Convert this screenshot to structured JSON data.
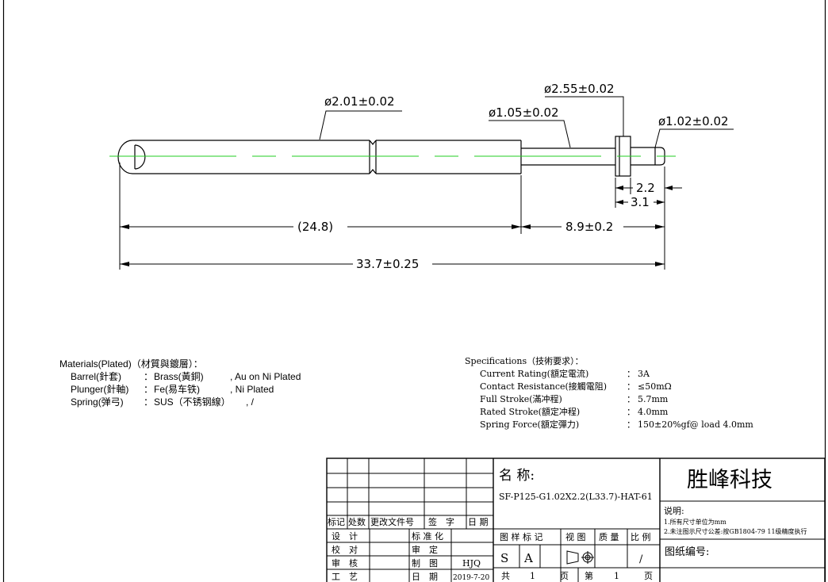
{
  "dimensions": {
    "d_barrel": "ø2.01±0.02",
    "d_plunger": "ø1.05±0.02",
    "d_collar": "ø2.55±0.02",
    "d_tip": "ø1.02±0.02",
    "len_a": "2.2",
    "len_b": "3.1",
    "len_barrel": "(24.8)",
    "len_plunger": "8.9±0.2",
    "len_total": "33.7±0.25"
  },
  "materials": {
    "title": "Materials(Plated)（材質與鍍層）：",
    "rows": [
      {
        "part": "Barrel(針套)",
        "sep": "：",
        "material": "Brass(黃銅)",
        "plating": ", Au on Ni Plated"
      },
      {
        "part": "Plunger(針軸)",
        "sep": "：",
        "material": "Fe(易车铁)",
        "plating": ", Ni Plated"
      },
      {
        "part": "Spring(弹弓)",
        "sep": "：",
        "material": "SUS（不锈钢線）",
        "plating": ", /"
      }
    ]
  },
  "specifications": {
    "title": "Specifications（技術要求）：",
    "rows": [
      {
        "label": "Current Rating(額定電流)",
        "sep": "：",
        "value": "3A"
      },
      {
        "label": "Contact Resistance(接觸電阻)",
        "sep": "：",
        "value": "≤50mΩ"
      },
      {
        "label": "Full Stroke(滿冲程)",
        "sep": "：",
        "value": "5.7mm"
      },
      {
        "label": "Rated Stroke(額定冲程)",
        "sep": "：",
        "value": "4.0mm"
      },
      {
        "label": "Spring Force(額定彈力)",
        "sep": "：",
        "value": "150±20%gf@ load 4.0mm"
      }
    ]
  },
  "title_block": {
    "rev_headers": [
      "标记",
      "处数",
      "更改文件号",
      "签　字",
      "日 期"
    ],
    "sign_rows": [
      {
        "l1": "设　计",
        "l2": "标 准 化",
        "v2": ""
      },
      {
        "l1": "校　对",
        "l2": "审　定",
        "v2": ""
      },
      {
        "l1": "审　核",
        "l2": "制　图",
        "v2": "HJQ"
      },
      {
        "l1": "工　艺",
        "l2": "日　期",
        "v2": "2019-7-20"
      }
    ],
    "name_label": "名 称:",
    "part_number": "SF-P125-G1.02X2.2(L33.7)-HAT-61",
    "company": "胜峰科技",
    "mark_labels": [
      "图 样 标 记",
      "视 图",
      "质 量",
      "比 例"
    ],
    "mark_values": [
      "S",
      "A",
      "",
      "/"
    ],
    "page_total_label": "共",
    "page_total": "1",
    "page_unit": "页",
    "page_no_label": "第",
    "page_no": "1",
    "notes_title": "说明:",
    "notes": [
      "1.所有尺寸单位为mm",
      "2.未注图示尺寸公差:按GB1804-79 11级精度执行"
    ],
    "drawing_no_label": "图纸编号:"
  }
}
